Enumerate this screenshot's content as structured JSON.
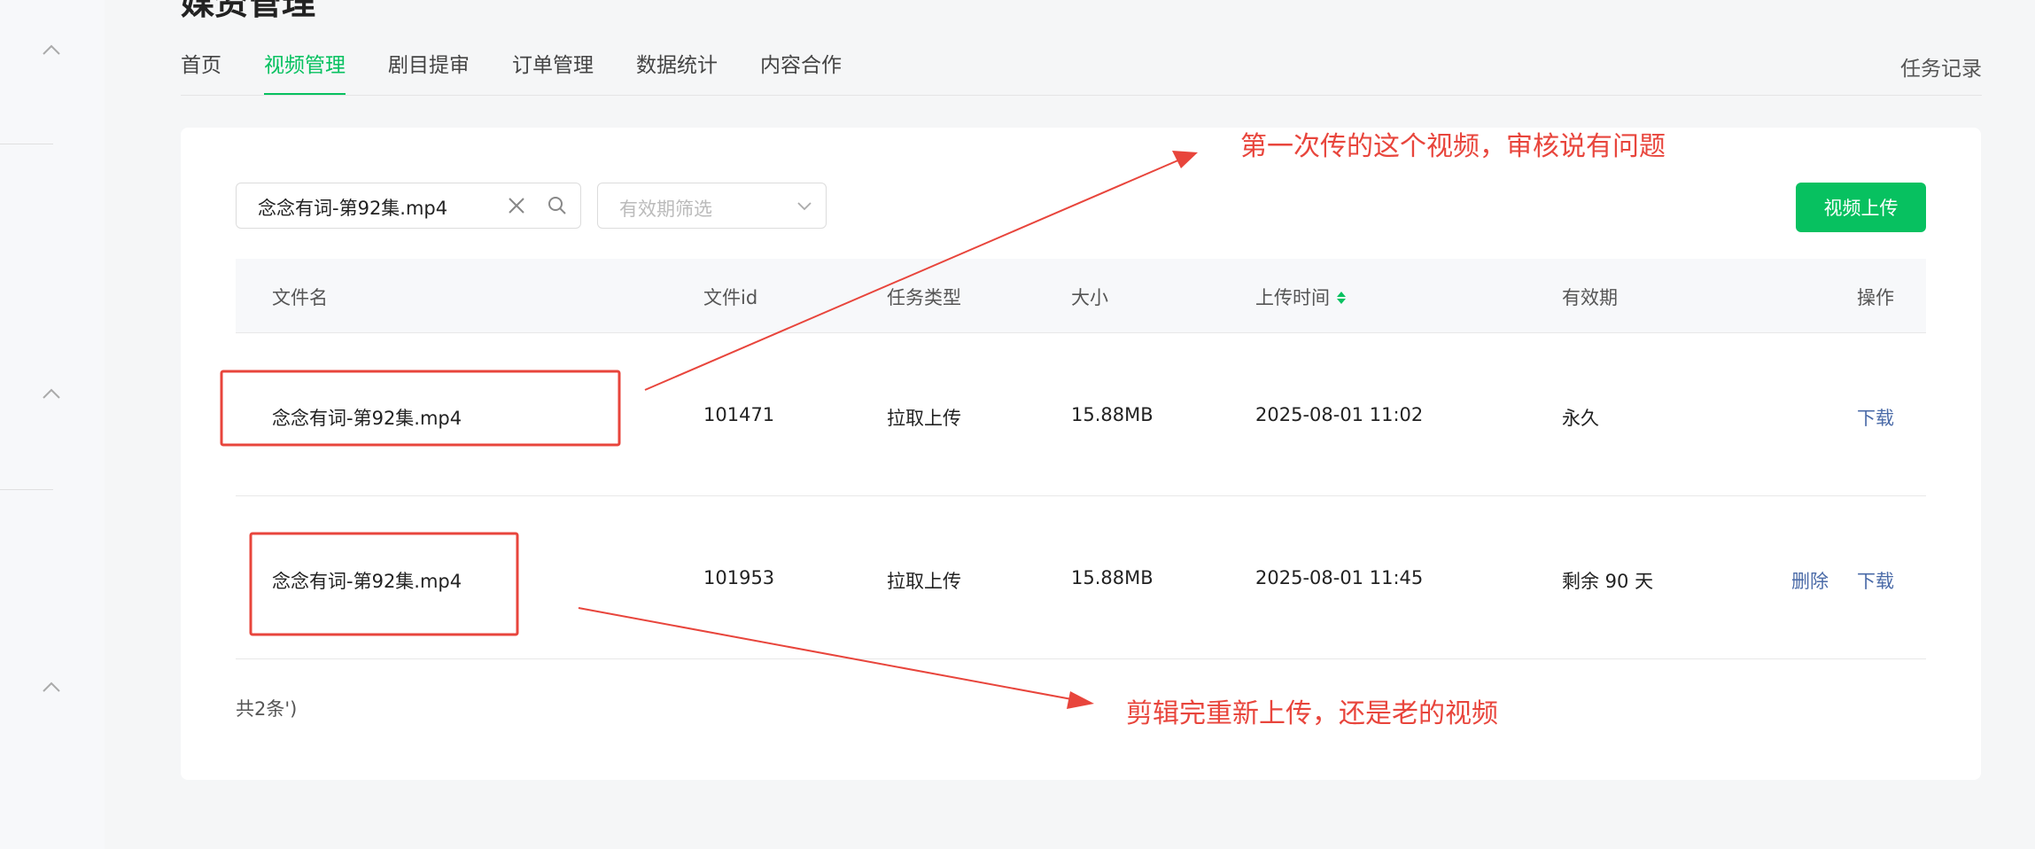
{
  "header": {
    "page_title": "媒资管理",
    "task_record": "任务记录",
    "tabs": [
      {
        "label": "首页"
      },
      {
        "label": "视频管理"
      },
      {
        "label": "剧目提审"
      },
      {
        "label": "订单管理"
      },
      {
        "label": "数据统计"
      },
      {
        "label": "内容合作"
      }
    ]
  },
  "toolbar": {
    "search_value": "念念有词-第92集.mp4",
    "filter_placeholder": "有效期筛选",
    "upload_label": "视频上传"
  },
  "table": {
    "columns": [
      "文件名",
      "文件id",
      "任务类型",
      "大小",
      "上传时间",
      "有效期",
      "操作"
    ],
    "rows": [
      {
        "file_name": "念念有词-第92集.mp4",
        "file_id": "101471",
        "task_type": "拉取上传",
        "size": "15.88MB",
        "upload_time": "2025-08-01 11:02",
        "validity": "永久",
        "actions": [
          "下载"
        ]
      },
      {
        "file_name": "念念有词-第92集.mp4",
        "file_id": "101953",
        "task_type": "拉取上传",
        "size": "15.88MB",
        "upload_time": "2025-08-01 11:45",
        "validity": "剩余 90 天",
        "actions": [
          "删除",
          "下载"
        ]
      }
    ],
    "total": "共2条')"
  },
  "annotations": {
    "top_note": "第一次传的这个视频，审核说有问题",
    "bottom_note": "剪辑完重新上传，还是老的视频",
    "color": "#e8453c"
  },
  "colors": {
    "accent": "#07c160",
    "link": "#4b6ba8"
  }
}
